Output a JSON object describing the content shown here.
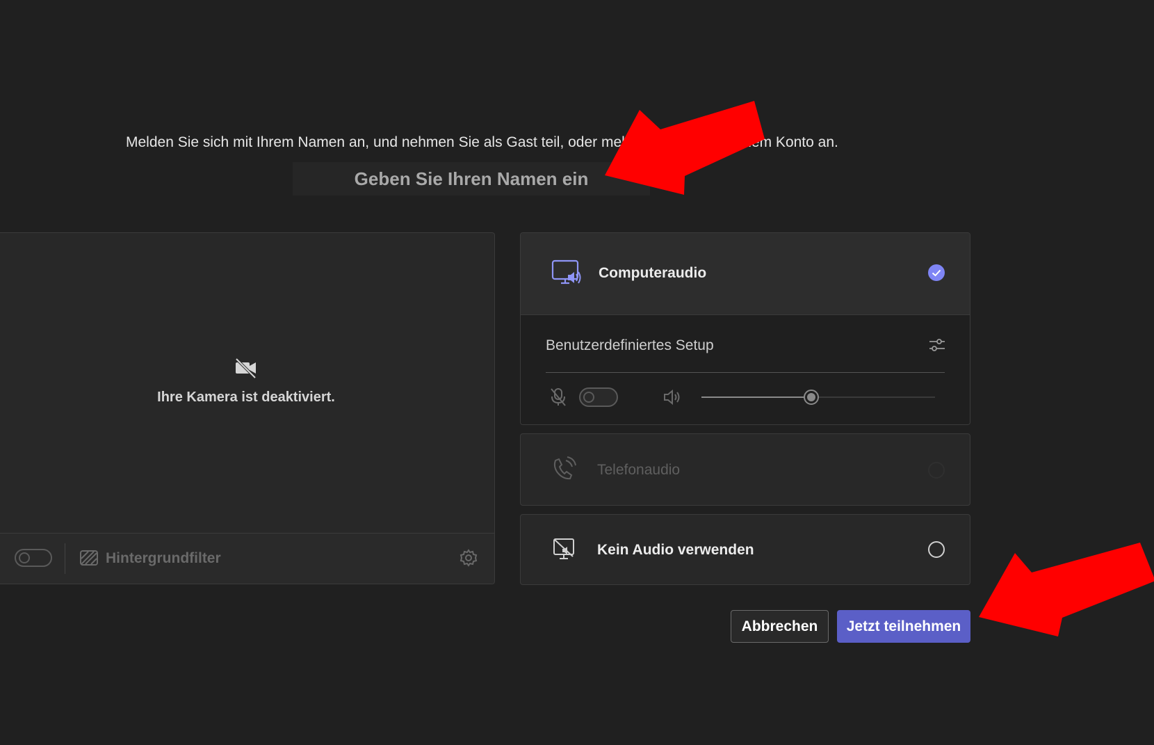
{
  "intro": {
    "text": "Melden Sie sich mit Ihrem Namen an, und nehmen Sie als Gast teil, oder melden Sie sich mit einem Konto an."
  },
  "name_input": {
    "placeholder": "Geben Sie Ihren Namen ein",
    "value": ""
  },
  "camera": {
    "status": "Ihre Kamera ist deaktiviert.",
    "camera_on": false,
    "background_filter_label": "Hintergrundfilter",
    "icons": {
      "camera": "camera-off-icon",
      "background": "background-filter-icon",
      "settings": "gear-icon"
    }
  },
  "audio": {
    "options": [
      {
        "label": "Computeraudio",
        "selected": true,
        "icon": "computer-audio-icon"
      },
      {
        "label": "Telefonaudio",
        "selected": false,
        "disabled": true,
        "icon": "phone-audio-icon"
      },
      {
        "label": "Kein Audio verwenden",
        "selected": false,
        "icon": "no-audio-icon"
      }
    ],
    "setup": {
      "label": "Benutzerdefiniertes Setup",
      "mic_on": false,
      "volume_fraction": 0.47,
      "icons": {
        "settings": "sliders-icon",
        "mic": "mic-off-icon",
        "speaker": "speaker-icon"
      }
    }
  },
  "buttons": {
    "cancel": "Abbrechen",
    "join": "Jetzt teilnehmen"
  },
  "colors": {
    "background": "#202020",
    "accent": "#5b5fc7",
    "selected_radio": "#7f85f5",
    "annotation_arrow": "#ff0000"
  }
}
